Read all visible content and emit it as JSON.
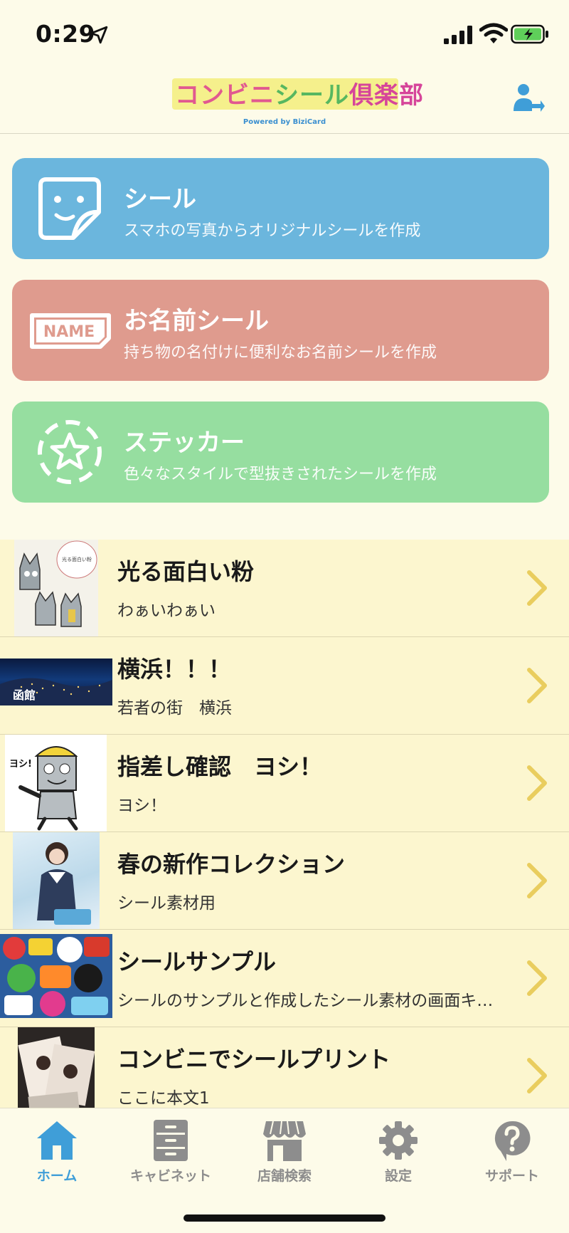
{
  "status_bar": {
    "time": "0:29"
  },
  "header": {
    "logo": {
      "part1": "コンビニ",
      "part2": "シール",
      "part3": "倶楽部",
      "powered_by": "Powered by BiziCard"
    }
  },
  "cards": [
    {
      "title": "シール",
      "description": "スマホの写真からオリジナルシールを作成",
      "color": "#6bb6dd"
    },
    {
      "title": "お名前シール",
      "description": "持ち物の名付けに便利なお名前シールを作成",
      "icon_text": "NAME",
      "color": "#df9b8e"
    },
    {
      "title": "ステッカー",
      "description": "色々なスタイルで型抜きされたシールを作成",
      "color": "#96dea0"
    }
  ],
  "list_items": [
    {
      "title": "光る面白い粉",
      "subtitle": "わぁいわぁい",
      "thumb_text": "光る面白い粉があるんだけど見に来ない？"
    },
    {
      "title": "横浜！！！",
      "subtitle": "若者の街　横浜",
      "thumb_text": "函館"
    },
    {
      "title": "指差し確認　ヨシ！",
      "subtitle": "ヨシ！",
      "thumb_text": "ヨシ!"
    },
    {
      "title": "春の新作コレクション",
      "subtitle": "シール素材用"
    },
    {
      "title": "シールサンプル",
      "subtitle": "シールのサンプルと作成したシール素材の画面キ…"
    },
    {
      "title": "コンビニでシールプリント",
      "subtitle": "ここに本文1"
    }
  ],
  "tabs": [
    {
      "label": "ホーム",
      "icon": "home-icon",
      "active": true
    },
    {
      "label": "キャビネット",
      "icon": "cabinet-icon",
      "active": false
    },
    {
      "label": "店舗検索",
      "icon": "store-icon",
      "active": false
    },
    {
      "label": "設定",
      "icon": "gear-icon",
      "active": false
    },
    {
      "label": "サポート",
      "icon": "help-icon",
      "active": false
    }
  ],
  "colors": {
    "accent": "#3f9ed8",
    "background": "#fdfbe9",
    "list_bg": "#fcf6cf",
    "chevron": "#e9cd5e"
  }
}
